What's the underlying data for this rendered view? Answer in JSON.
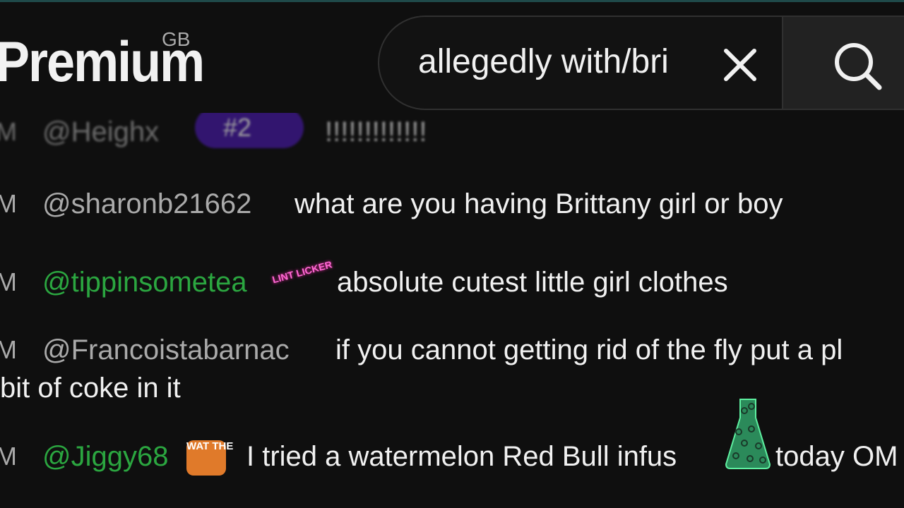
{
  "header": {
    "logo_text": "Premium",
    "region": "GB",
    "search_value": "allegedly with/bri",
    "accent": "#f1f1f1"
  },
  "icons": {
    "clear": "close-icon",
    "search": "search-icon"
  },
  "chat": {
    "top_partial": {
      "time": "M",
      "author": "@Heighx",
      "badge": "#2",
      "message": "!!!!!!!!!!!!!"
    },
    "messages": [
      {
        "time": "M",
        "author": "@sharonb21662",
        "member": false,
        "message": "what are you having Brittany girl or boy"
      },
      {
        "time": "M",
        "author": "@tippinsometea",
        "member": true,
        "emote": "LINT LICKER",
        "message": "absolute cutest little girl clothes"
      },
      {
        "time": "M",
        "author": "@Francoistabarnac",
        "member": false,
        "message": "if you cannot getting rid of the fly put a pl",
        "message_cont": "bit of coke in it"
      },
      {
        "time": "M",
        "author": "@Jiggy68",
        "member": true,
        "emote": "WAT THE",
        "message": "I tried a watermelon Red Bull infus",
        "message_tail": "today OM"
      }
    ]
  },
  "colors": {
    "member_name": "#2ba640",
    "author_name": "#aaaaaa",
    "background": "#0f0f0f"
  }
}
